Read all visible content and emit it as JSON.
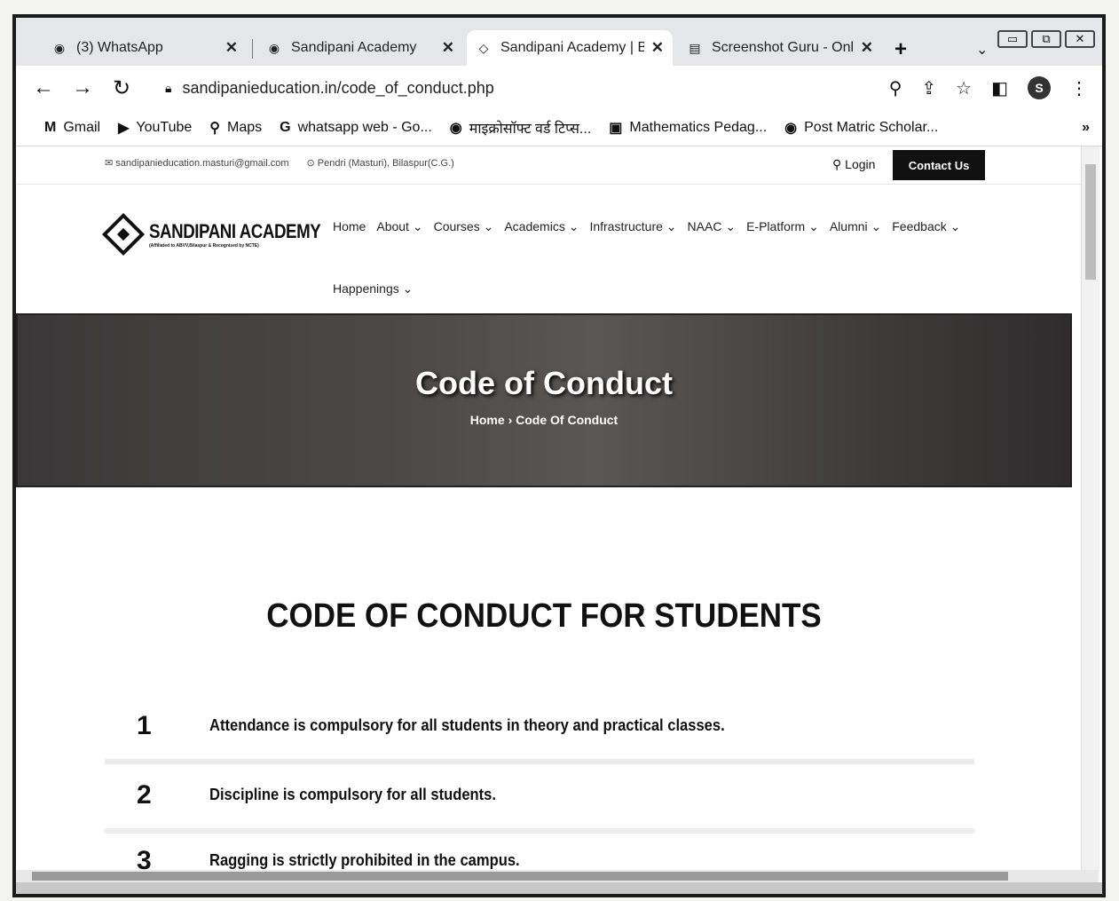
{
  "tabs": [
    {
      "label": "(3) WhatsApp",
      "icon": "whatsapp-icon",
      "active": false
    },
    {
      "label": "Sandipani Academy",
      "icon": "globe-icon",
      "active": false
    },
    {
      "label": "Sandipani Academy | Bila",
      "icon": "diamond-logo-icon",
      "active": true
    },
    {
      "label": "Screenshot Guru - Online",
      "icon": "screenshot-icon",
      "active": false
    }
  ],
  "address": {
    "url": "sandipanieducation.in/code_of_conduct.php"
  },
  "bookmarks": [
    {
      "label": "Gmail",
      "icon": "gmail-icon",
      "glyph": "M"
    },
    {
      "label": "YouTube",
      "icon": "youtube-icon",
      "glyph": "▶"
    },
    {
      "label": "Maps",
      "icon": "maps-pin-icon",
      "glyph": "⚲"
    },
    {
      "label": "whatsapp web - Go...",
      "icon": "google-icon",
      "glyph": "G"
    },
    {
      "label": "माइक्रोसॉफ्ट वर्ड टिप्स...",
      "icon": "globe-icon",
      "glyph": "◉"
    },
    {
      "label": "Mathematics Pedag...",
      "icon": "bookmark-page-icon",
      "glyph": "▣"
    },
    {
      "label": "Post Matric Scholar...",
      "icon": "globe-icon",
      "glyph": "◉"
    }
  ],
  "site": {
    "email": "sandipanieducation.masturi@gmail.com",
    "location": "Pendri (Masturi), Bilaspur(C.G.)",
    "login": "Login",
    "contact_us": "Contact Us",
    "logo_name": "SANDIPANI ACADEMY",
    "logo_sub": "(Affiliated to ABVV,Bilaspur & Recognised by NCTE)",
    "menu": [
      "Home",
      "About ⌄",
      "Courses ⌄",
      "Academics ⌄",
      "Infrastructure ⌄",
      "NAAC ⌄",
      "E-Platform ⌄",
      "Alumni ⌄",
      "Feedback ⌄"
    ],
    "menu_second_row": "Happenings ⌄"
  },
  "hero": {
    "title": "Code of Conduct",
    "breadcrumb_home": "Home",
    "breadcrumb_sep": "›",
    "breadcrumb_current": "Code Of Conduct"
  },
  "content": {
    "title": "CODE OF CONDUCT FOR STUDENTS",
    "rules": [
      {
        "num": "1",
        "text": "Attendance is compulsory for all students in theory and practical classes."
      },
      {
        "num": "2",
        "text": "Discipline is compulsory for all students."
      },
      {
        "num": "3",
        "text": "Ragging is strictly prohibited in the campus."
      }
    ]
  },
  "profile_initial": "S"
}
